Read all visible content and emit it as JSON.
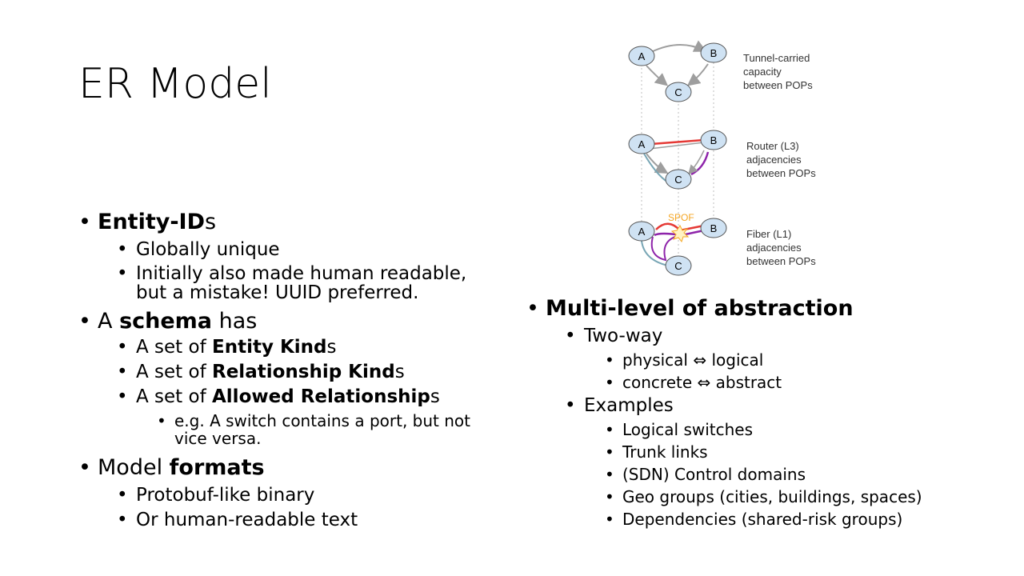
{
  "slide": {
    "title": "ER Model"
  },
  "left": {
    "entity": {
      "bold": "Entity-IDs",
      "rest": "s"
    },
    "entity_sub": [
      "Globally unique",
      "Initially also made human readable,",
      "but a mistake! UUID preferred."
    ],
    "schema": {
      "pre": "A ",
      "bold": "schema",
      "post": " has"
    },
    "schema_items": [
      {
        "pre": "A set of ",
        "bold": "Entity Kind",
        "post": "s"
      },
      {
        "pre": "A set of ",
        "bold": "Relationship Kind",
        "post": "s"
      },
      {
        "pre": "A set of ",
        "bold": "Allowed Relationship",
        "post": "s"
      }
    ],
    "example_line1": "e.g. A switch contains a port, but not",
    "example_line2": "vice versa.",
    "formats": {
      "pre": "Model ",
      "bold": "formats"
    },
    "format_items": [
      "Protobuf-like binary",
      "Or human-readable  text"
    ]
  },
  "right": {
    "heading": "Multi-level of abstraction",
    "twoway": "Two-way",
    "twoway_items": [
      "physical ⇔ logical",
      "concrete ⇔ abstract"
    ],
    "examples": "Examples",
    "example_items": [
      "Logical switches",
      "Trunk links",
      "(SDN) Control domains",
      "Geo groups (cities, buildings, spaces)",
      "Dependencies  (shared-risk groups)"
    ]
  },
  "diagram": {
    "node_a": "A",
    "node_b": "B",
    "node_c": "C",
    "spof": "SPOF",
    "layer1": [
      "Tunnel-carried",
      "capacity",
      "between POPs"
    ],
    "layer2": [
      "Router (L3)",
      "adjacencies",
      "between POPs"
    ],
    "layer3": [
      "Fiber (L1)",
      "adjacencies",
      "between POPs"
    ],
    "colors": {
      "node_fill": "#cfe2f3",
      "arrow": "#9e9e9e",
      "red": "#e53935",
      "purple": "#8e24aa",
      "teal": "#78a6b5",
      "spof": "#f5a623"
    }
  }
}
